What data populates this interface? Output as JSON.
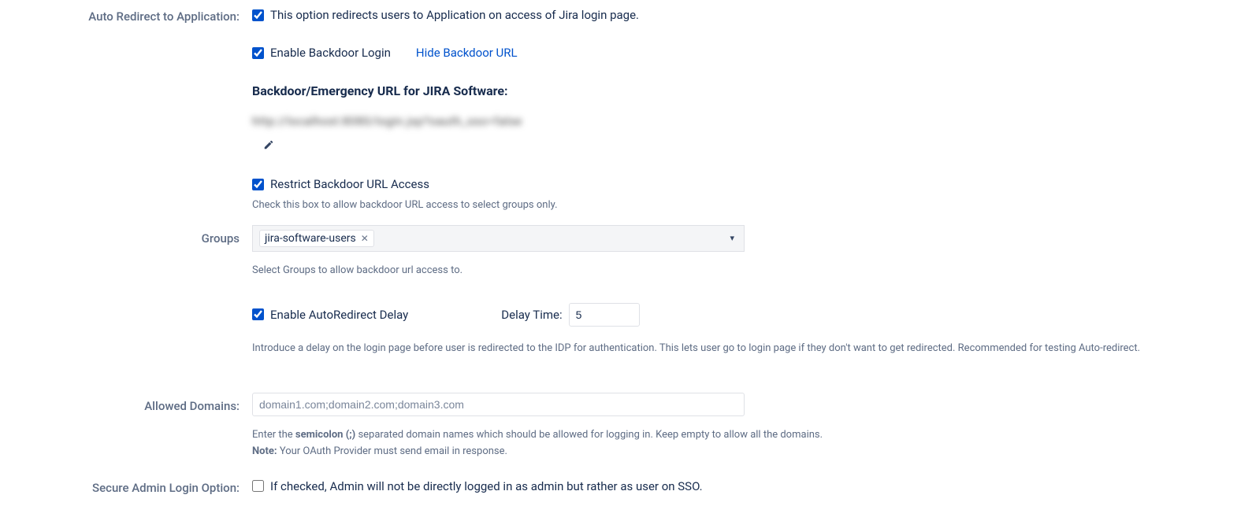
{
  "auto_redirect": {
    "label": "Auto Redirect to Application:",
    "redirect_checked": true,
    "redirect_text": "This option redirects users to Application on access of Jira login page.",
    "enable_backdoor_checked": true,
    "enable_backdoor_label": "Enable Backdoor Login",
    "hide_backdoor_link": "Hide Backdoor URL",
    "backdoor_heading": "Backdoor/Emergency URL for JIRA Software:",
    "backdoor_url_blurred": "http://localhost:8080/login.jsp?oauth_sso=false",
    "restrict_checked": true,
    "restrict_label": "Restrict Backdoor URL Access",
    "restrict_hint": "Check this box to allow backdoor URL access to select groups only."
  },
  "groups": {
    "label": "Groups",
    "selected_tag": "jira-software-users",
    "hint": "Select Groups to allow backdoor url access to."
  },
  "autoredirect_delay": {
    "checked": true,
    "label": "Enable AutoRedirect Delay",
    "delay_label": "Delay Time:",
    "delay_value": "5",
    "hint": "Introduce a delay on the login page before user is redirected to the IDP for authentication. This lets user go to login page if they don't want to get redirected. Recommended for testing Auto-redirect."
  },
  "allowed_domains": {
    "label": "Allowed Domains:",
    "placeholder": "domain1.com;domain2.com;domain3.com",
    "hint_prefix": "Enter the ",
    "hint_bold": "semicolon (;)",
    "hint_suffix": " separated domain names which should be allowed for logging in. Keep empty to allow all the domains.",
    "note_label": "Note:",
    "note_text": " Your OAuth Provider must send email in response."
  },
  "secure_admin": {
    "label": "Secure Admin Login Option:",
    "checked": false,
    "text": "If checked, Admin will not be directly logged in as admin but rather as user on SSO."
  }
}
